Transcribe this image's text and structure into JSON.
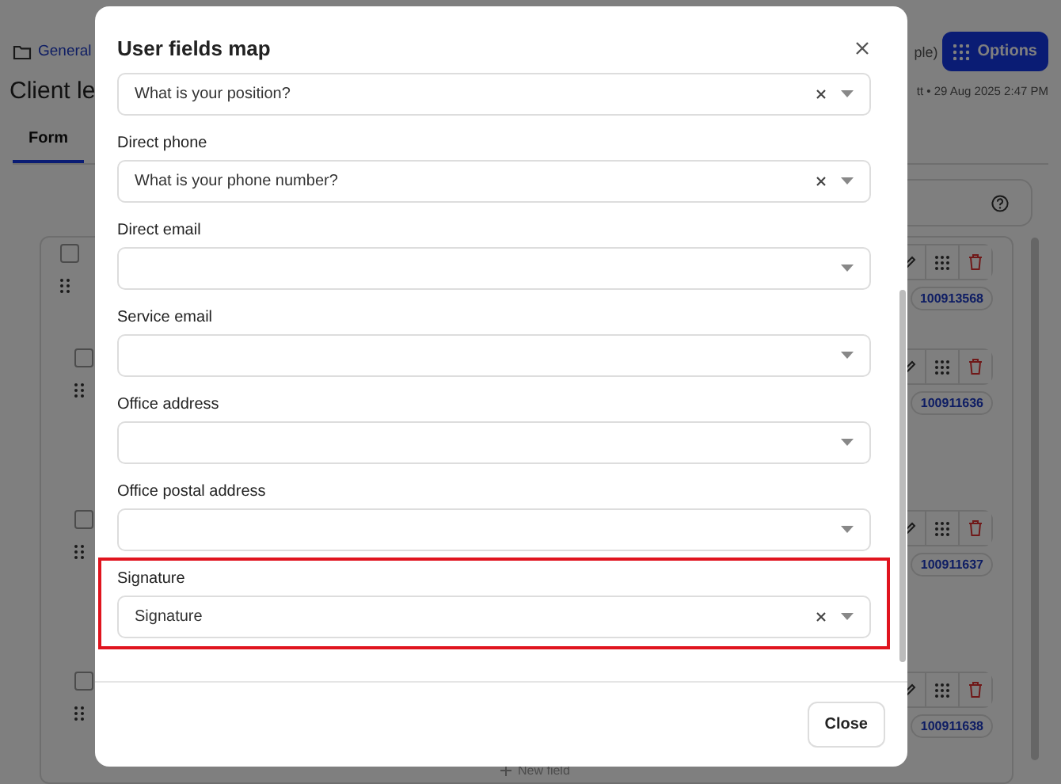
{
  "background": {
    "breadcrumb": "General",
    "title": "Client le",
    "header_note": "ple)",
    "options_button": "Options",
    "meta": "tt • 29 Aug 2025 2:47 PM",
    "tabs": [
      {
        "label": "Form",
        "selected": true
      }
    ],
    "rows": [
      {
        "id": "100913568",
        "checked": false,
        "nested": false
      },
      {
        "id": "100911636",
        "checked": false,
        "nested": true
      },
      {
        "id": "100911637",
        "checked": false,
        "nested": true
      },
      {
        "id": "100911638",
        "checked": false,
        "nested": true
      }
    ],
    "new_field": "New field"
  },
  "dialog": {
    "title": "User fields map",
    "close_button": "Close",
    "fields": [
      {
        "value": "What is your position?",
        "highlighted": false
      },
      {
        "label": "Direct phone",
        "value": "What is your phone number?",
        "highlighted": false
      },
      {
        "label": "Direct email",
        "highlighted": false
      },
      {
        "label": "Service email",
        "highlighted": false
      },
      {
        "label": "Office address",
        "highlighted": false
      },
      {
        "label": "Office postal address",
        "highlighted": false
      },
      {
        "label": "Signature",
        "value": "Signature",
        "highlighted": true
      }
    ]
  }
}
